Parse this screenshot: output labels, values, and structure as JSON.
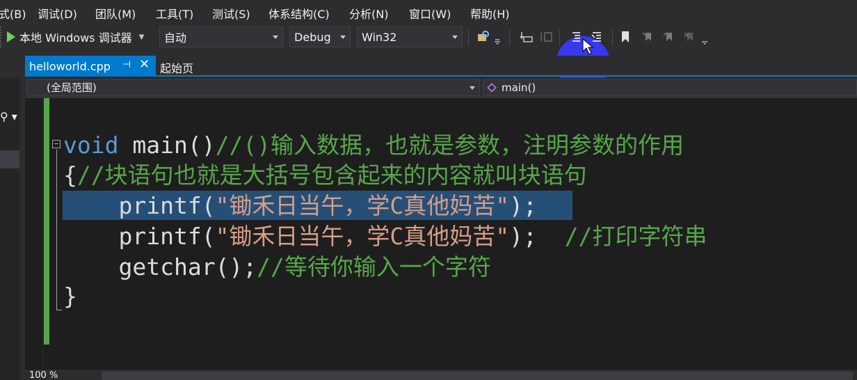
{
  "menu": [
    "式(B)",
    "调试(D)",
    "团队(M)",
    "工具(T)",
    "测试(S)",
    "体系结构(C)",
    "分析(N)",
    "窗口(W)",
    "帮助(H)"
  ],
  "toolbar": {
    "run_label": "本地 Windows 调试器",
    "auto_combo": "自动",
    "config_combo": "Debug",
    "platform_combo": "Win32"
  },
  "tabs": {
    "active": "helloworld.cpp",
    "inactive": "起始页"
  },
  "navbar": {
    "scope": "(全局范围)",
    "member": "main()"
  },
  "editor": {
    "lines": [
      {
        "kw": "void",
        "fn": " main()",
        "cmt": "//()输入数据，也就是参数，注明参数的作用"
      },
      {
        "plain": "{",
        "cmt": "//块语句也就是大括号包含起来的内容就叫块语句"
      },
      {
        "indent": "    ",
        "fn": "printf(",
        "str": "\"锄禾日当午，学C真他妈苦\"",
        "plain": ");"
      },
      {
        "indent": "    ",
        "fn": "printf(",
        "str": "\"锄禾日当午，学C真他妈苦\"",
        "plain": ");  ",
        "cmt": "//打印字符串"
      },
      {
        "indent": "    ",
        "fn": "getchar();",
        "cmt": "//等待你输入一个字符"
      },
      {
        "plain": "}"
      }
    ]
  },
  "status": {
    "zoom": "100 %"
  },
  "colors": {
    "accent": "#007acc",
    "keyword": "#569cd6",
    "string": "#d69d85",
    "comment": "#57a64a",
    "highlight": "#3a3aff"
  }
}
